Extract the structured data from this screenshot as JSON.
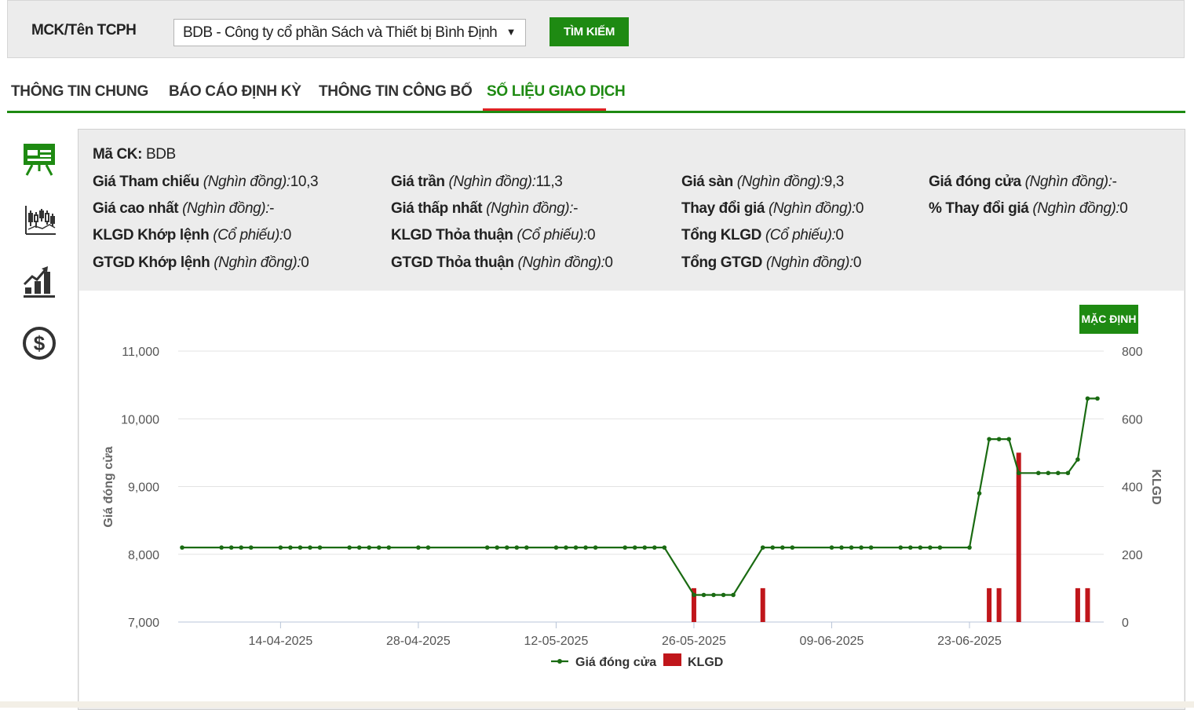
{
  "search": {
    "label": "MCK/Tên TCPH",
    "selected": "BDB - Công ty cổ phần Sách và Thiết bị Bình Định",
    "button": "TÌM KIẾM"
  },
  "tabs": [
    "THÔNG TIN CHUNG",
    "BÁO CÁO ĐỊNH KỲ",
    "THÔNG TIN CÔNG BỐ",
    "SỐ LIỆU GIAO DỊCH"
  ],
  "active_tab": "SỐ LIỆU GIAO DỊCH",
  "sidebar_icons": [
    "presentation-board-icon",
    "candlestick-chart-icon",
    "bar-growth-chart-icon",
    "dollar-coin-icon"
  ],
  "info": {
    "ma_ck": {
      "label": "Mã CK:",
      "value": "BDB"
    },
    "rows": [
      [
        {
          "label": "Giá Tham chiếu",
          "unit": "(Nghìn đồng):",
          "value": "10,3"
        },
        {
          "label": "Giá trần",
          "unit": "(Nghìn đồng):",
          "value": "11,3"
        },
        {
          "label": "Giá sàn",
          "unit": "(Nghìn đồng):",
          "value": "9,3"
        },
        {
          "label": "Giá đóng cửa",
          "unit": "(Nghìn đồng):",
          "value": "-"
        }
      ],
      [
        {
          "label": "Giá cao nhất",
          "unit": "(Nghìn đồng):",
          "value": "-"
        },
        {
          "label": "Giá thấp nhất",
          "unit": "(Nghìn đồng):",
          "value": "-"
        },
        {
          "label": "Thay đổi giá",
          "unit": "(Nghìn đồng):",
          "value": "0"
        },
        {
          "label": "% Thay đổi giá",
          "unit": "(Nghìn đồng):",
          "value": "0"
        }
      ],
      [
        {
          "label": "KLGD Khớp lệnh",
          "unit": "(Cổ phiếu):",
          "value": "0"
        },
        {
          "label": "KLGD Thỏa thuận",
          "unit": "(Cổ phiếu):",
          "value": "0"
        },
        {
          "label": "Tổng KLGD",
          "unit": "(Cổ phiếu):",
          "value": "0"
        }
      ],
      [
        {
          "label": "GTGD Khớp lệnh",
          "unit": "(Nghìn đồng):",
          "value": "0"
        },
        {
          "label": "GTGD Thỏa thuận",
          "unit": "(Nghìn đồng):",
          "value": "0"
        },
        {
          "label": "Tổng GTGD",
          "unit": "(Nghìn đồng):",
          "value": "0"
        }
      ]
    ]
  },
  "default_button": "MẶC ĐỊNH",
  "colors": {
    "accent": "#1e8a12",
    "line": "#1a6b12",
    "bar": "#c0161b",
    "tab_underline": "#dd2222"
  },
  "chart_data": {
    "type": "line",
    "x_ticks": [
      "14-04-2025",
      "28-04-2025",
      "12-05-2025",
      "26-05-2025",
      "09-06-2025",
      "23-06-2025"
    ],
    "y_left": {
      "label": "Giá đóng cửa",
      "ticks": [
        "11,000",
        "10,000",
        "9,000",
        "8,000",
        "7,000"
      ],
      "range": [
        7000,
        11000
      ]
    },
    "y_right": {
      "label": "KLGD",
      "ticks": [
        "800",
        "600",
        "400",
        "200",
        "0"
      ],
      "range": [
        0,
        800
      ]
    },
    "legend": [
      "Giá đóng cửa",
      "KLGD"
    ],
    "legend_position": "bottom",
    "grid": true,
    "series": [
      {
        "name": "Giá đóng cửa",
        "points": [
          [
            "2025-04-04",
            8100
          ],
          [
            "2025-04-08",
            8100
          ],
          [
            "2025-04-09",
            8100
          ],
          [
            "2025-04-10",
            8100
          ],
          [
            "2025-04-11",
            8100
          ],
          [
            "2025-04-14",
            8100
          ],
          [
            "2025-04-15",
            8100
          ],
          [
            "2025-04-16",
            8100
          ],
          [
            "2025-04-17",
            8100
          ],
          [
            "2025-04-18",
            8100
          ],
          [
            "2025-04-21",
            8100
          ],
          [
            "2025-04-22",
            8100
          ],
          [
            "2025-04-23",
            8100
          ],
          [
            "2025-04-24",
            8100
          ],
          [
            "2025-04-25",
            8100
          ],
          [
            "2025-04-28",
            8100
          ],
          [
            "2025-04-29",
            8100
          ],
          [
            "2025-05-05",
            8100
          ],
          [
            "2025-05-06",
            8100
          ],
          [
            "2025-05-07",
            8100
          ],
          [
            "2025-05-08",
            8100
          ],
          [
            "2025-05-09",
            8100
          ],
          [
            "2025-05-12",
            8100
          ],
          [
            "2025-05-13",
            8100
          ],
          [
            "2025-05-14",
            8100
          ],
          [
            "2025-05-15",
            8100
          ],
          [
            "2025-05-16",
            8100
          ],
          [
            "2025-05-19",
            8100
          ],
          [
            "2025-05-20",
            8100
          ],
          [
            "2025-05-21",
            8100
          ],
          [
            "2025-05-22",
            8100
          ],
          [
            "2025-05-23",
            8100
          ],
          [
            "2025-05-26",
            7400
          ],
          [
            "2025-05-27",
            7400
          ],
          [
            "2025-05-28",
            7400
          ],
          [
            "2025-05-29",
            7400
          ],
          [
            "2025-05-30",
            7400
          ],
          [
            "2025-06-02",
            8100
          ],
          [
            "2025-06-03",
            8100
          ],
          [
            "2025-06-04",
            8100
          ],
          [
            "2025-06-05",
            8100
          ],
          [
            "2025-06-09",
            8100
          ],
          [
            "2025-06-10",
            8100
          ],
          [
            "2025-06-11",
            8100
          ],
          [
            "2025-06-12",
            8100
          ],
          [
            "2025-06-13",
            8100
          ],
          [
            "2025-06-16",
            8100
          ],
          [
            "2025-06-17",
            8100
          ],
          [
            "2025-06-18",
            8100
          ],
          [
            "2025-06-19",
            8100
          ],
          [
            "2025-06-20",
            8100
          ],
          [
            "2025-06-23",
            8100
          ],
          [
            "2025-06-24",
            8900
          ],
          [
            "2025-06-25",
            9700
          ],
          [
            "2025-06-26",
            9700
          ],
          [
            "2025-06-27",
            9700
          ],
          [
            "2025-06-28",
            9200
          ],
          [
            "2025-06-30",
            9200
          ],
          [
            "2025-07-01",
            9200
          ],
          [
            "2025-07-02",
            9200
          ],
          [
            "2025-07-03",
            9200
          ],
          [
            "2025-07-04",
            9400
          ],
          [
            "2025-07-05",
            10300
          ],
          [
            "2025-07-06",
            10300
          ]
        ]
      },
      {
        "name": "KLGD",
        "points": [
          [
            "2025-05-26",
            100
          ],
          [
            "2025-06-02",
            100
          ],
          [
            "2025-06-25",
            100
          ],
          [
            "2025-06-26",
            100
          ],
          [
            "2025-06-28",
            500
          ],
          [
            "2025-07-04",
            100
          ],
          [
            "2025-07-05",
            100
          ]
        ]
      }
    ]
  }
}
